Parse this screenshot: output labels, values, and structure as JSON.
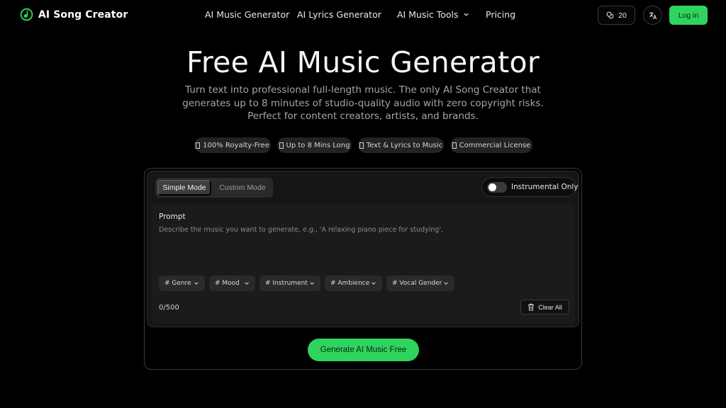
{
  "header": {
    "logo_text": "AI Song Creator",
    "nav": [
      {
        "label": "AI Music Generator"
      },
      {
        "label": "AI Lyrics Generator"
      },
      {
        "label": "AI Music Tools"
      },
      {
        "label": "Pricing"
      }
    ],
    "credits": "20",
    "login_label": "Log in"
  },
  "hero": {
    "title": "Free AI Music Generator",
    "subtitle": "Turn text into professional full-length music. The only AI Song Creator that generates up to 8 minutes of studio-quality audio with zero copyright risks. Perfect for content creators, artists, and brands."
  },
  "badges": [
    {
      "label": "100% Royalty-Free"
    },
    {
      "label": "Up to 8 Mins Long"
    },
    {
      "label": "Text & Lyrics to Music"
    },
    {
      "label": "Commercial License"
    }
  ],
  "generator": {
    "modes": [
      {
        "label": "Simple Mode",
        "active": true
      },
      {
        "label": "Custom Mode",
        "active": false
      }
    ],
    "instrumental_label": "Instrumental Only",
    "instrumental_on": false,
    "prompt_label": "Prompt",
    "prompt_placeholder": "Describe the music you want to generate, e.g., 'A relaxing piano piece for studying'.",
    "prompt_value": "",
    "tags": [
      {
        "label": "# Genre"
      },
      {
        "label": "# Mood"
      },
      {
        "label": "# Instrument"
      },
      {
        "label": "# Ambience"
      },
      {
        "label": "# Vocal Gender"
      }
    ],
    "counter": "0/500",
    "clear_label": "Clear All",
    "generate_label": "Generate AI Music Free"
  },
  "colors": {
    "accent": "#2fd45e",
    "background": "#000000",
    "panel": "#151515"
  }
}
